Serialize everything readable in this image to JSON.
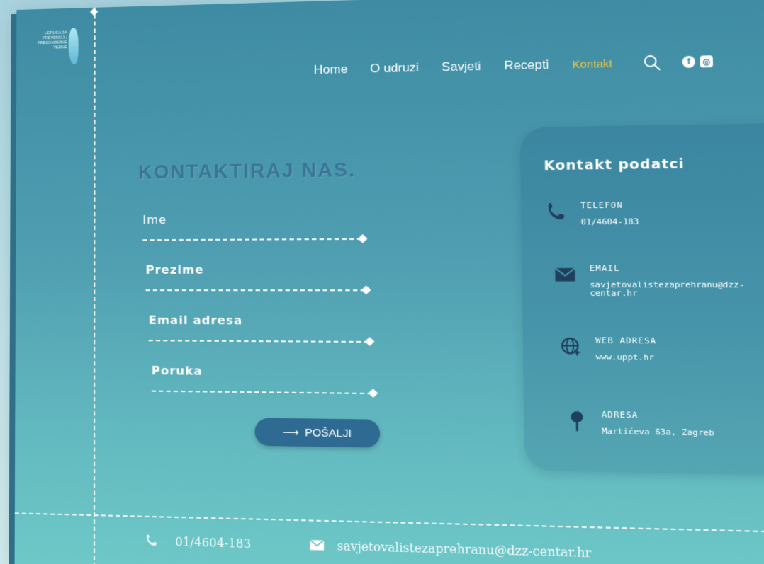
{
  "logo": {
    "text_lines": [
      "UDRUGA ZA",
      "PREVENCIJU",
      "PREKOMJERNE",
      "TEŽINE"
    ]
  },
  "nav": {
    "items": [
      {
        "label": "Home"
      },
      {
        "label": "O udruzi"
      },
      {
        "label": "Savjeti"
      },
      {
        "label": "Recepti"
      },
      {
        "label": "Kontakt",
        "active": true
      }
    ],
    "search_icon": "search-icon",
    "social_icons": [
      "facebook-icon",
      "instagram-icon"
    ]
  },
  "form": {
    "title": "KONTAKTIRAJ NAS.",
    "fields": [
      {
        "label": "Ime"
      },
      {
        "label": "Prezime"
      },
      {
        "label": "Email adresa"
      },
      {
        "label": "Poruka"
      }
    ],
    "submit_label": "POŠALJI",
    "submit_icon": "arrow-right-icon"
  },
  "contact_card": {
    "title": "Kontakt podatci",
    "items": [
      {
        "icon": "phone-icon",
        "key": "TELEFON",
        "value": "01/4604-183"
      },
      {
        "icon": "mail-icon",
        "key": "EMAIL",
        "value": "savjetovalistezaprehranu@dzz-centar.hr"
      },
      {
        "icon": "globe-icon",
        "key": "WEB ADRESA",
        "value": "www.uppt.hr"
      },
      {
        "icon": "pin-icon",
        "key": "ADRESA",
        "value": "Martićeva 63a, Zagreb"
      }
    ]
  },
  "footer": {
    "phone": "01/4604-183",
    "email": "savjetovalistezaprehranu@dzz-centar.hr"
  },
  "colors": {
    "accent": "#f2c53c",
    "button": "#2f6a92",
    "title": "#3a7598",
    "panel_top": "#3e8ba3",
    "panel_bottom": "#6ec8c7"
  }
}
